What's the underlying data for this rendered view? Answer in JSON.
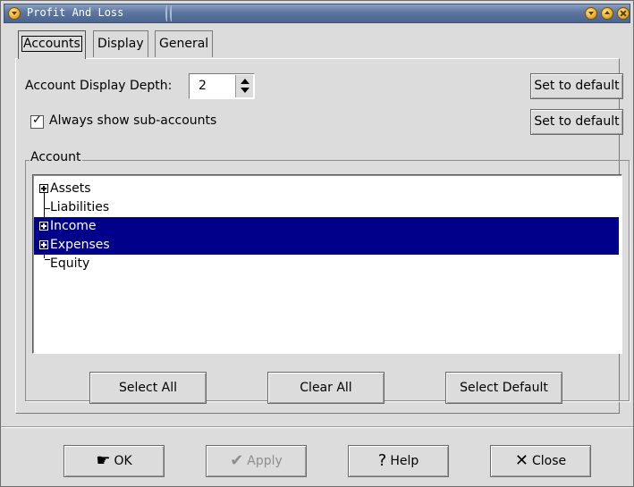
{
  "window": {
    "title": "Profit And Loss"
  },
  "tabs": [
    {
      "label": "Accounts",
      "active": true
    },
    {
      "label": "Display",
      "active": false
    },
    {
      "label": "General",
      "active": false
    }
  ],
  "accounts_tab": {
    "depth_label": "Account Display Depth:",
    "depth_value": "2",
    "set_default_label_1": "Set to default",
    "always_show_label": "Always show sub-accounts",
    "always_show_checked": true,
    "set_default_label_2": "Set to default",
    "frame_title": "Account",
    "tree": [
      {
        "label": "Assets",
        "expandable": true,
        "selected": false
      },
      {
        "label": "Liabilities",
        "expandable": false,
        "selected": false
      },
      {
        "label": "Income",
        "expandable": true,
        "selected": true
      },
      {
        "label": "Expenses",
        "expandable": true,
        "selected": true
      },
      {
        "label": "Equity",
        "expandable": false,
        "selected": false
      }
    ],
    "select_all_label": "Select All",
    "clear_all_label": "Clear All",
    "select_default_label": "Select Default"
  },
  "dialog_buttons": {
    "ok_label": "OK",
    "apply_label": "Apply",
    "help_label": "Help",
    "close_label": "Close"
  },
  "colors": {
    "selection": "#00008b",
    "titlebar": "#5c76a0",
    "background": "#dcdcdc"
  }
}
